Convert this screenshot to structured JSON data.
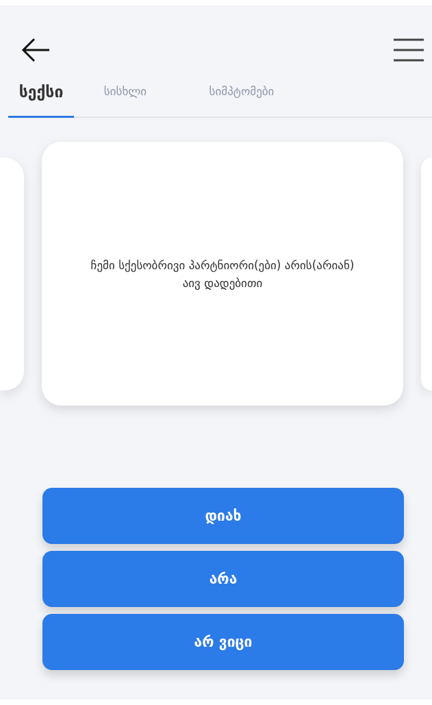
{
  "tabs": [
    {
      "label": "სექსი",
      "selected": true
    },
    {
      "label": "სისხლი",
      "selected": false
    },
    {
      "label": "სიმპტომები",
      "selected": false
    }
  ],
  "card": {
    "question": "ჩემი სქესობრივი პარტნიორი(ები) არის(არიან) აივ დადებითი"
  },
  "answers": [
    "დიახ",
    "არა",
    "არ ვიცი"
  ]
}
